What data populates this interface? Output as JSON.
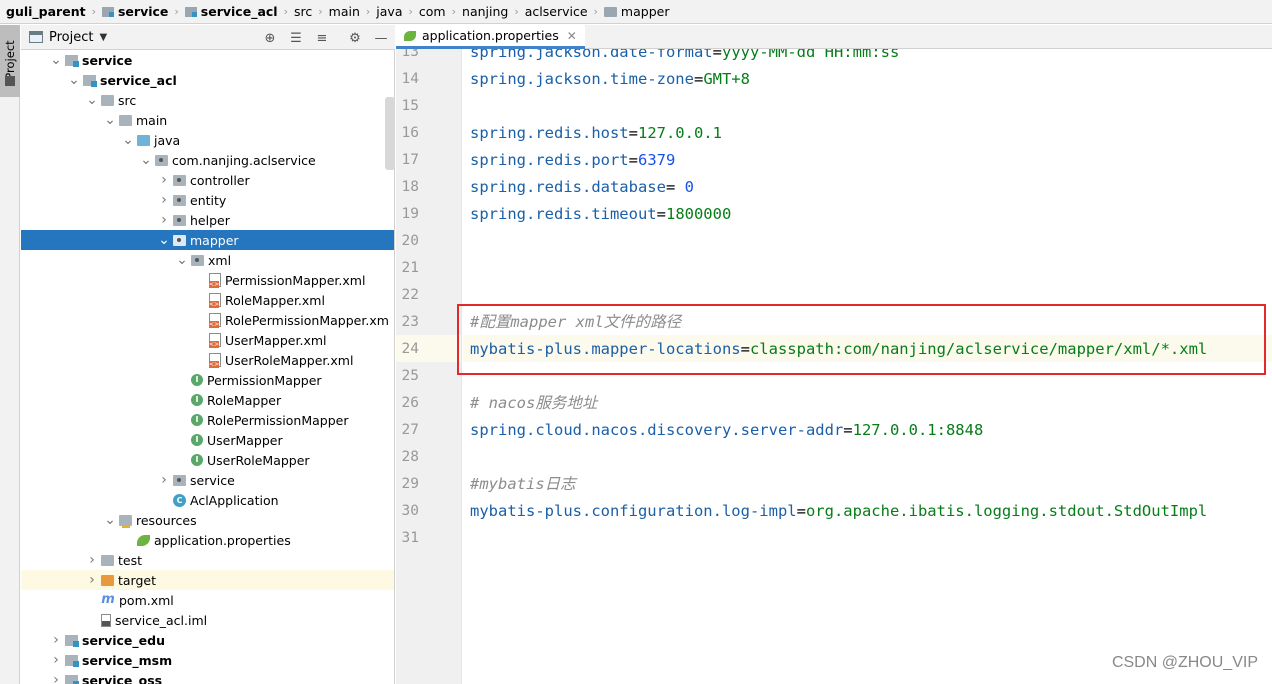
{
  "breadcrumb": [
    "guli_parent",
    "service",
    "service_acl",
    "src",
    "main",
    "java",
    "com",
    "nanjing",
    "aclservice",
    "mapper"
  ],
  "tool_strip": {
    "project_label": "Project"
  },
  "project_panel": {
    "title": "Project"
  },
  "tree": [
    {
      "label": "service",
      "bold": true,
      "arrow": "down",
      "icon": "module"
    },
    {
      "label": "service_acl",
      "bold": true,
      "arrow": "down",
      "icon": "module"
    },
    {
      "label": "src",
      "arrow": "down",
      "icon": "folder"
    },
    {
      "label": "main",
      "arrow": "down",
      "icon": "folder"
    },
    {
      "label": "java",
      "arrow": "down",
      "icon": "folder-blue"
    },
    {
      "label": "com.nanjing.aclservice",
      "arrow": "down",
      "icon": "pkg"
    },
    {
      "label": "controller",
      "arrow": "right",
      "icon": "pkg"
    },
    {
      "label": "entity",
      "arrow": "right",
      "icon": "pkg"
    },
    {
      "label": "helper",
      "arrow": "right",
      "icon": "pkg"
    },
    {
      "label": "mapper",
      "arrow": "down",
      "icon": "pkg",
      "selected": true
    },
    {
      "label": "xml",
      "arrow": "down",
      "icon": "pkg"
    },
    {
      "label": "PermissionMapper.xml",
      "icon": "xml"
    },
    {
      "label": "RoleMapper.xml",
      "icon": "xml"
    },
    {
      "label": "RolePermissionMapper.xm",
      "icon": "xml"
    },
    {
      "label": "UserMapper.xml",
      "icon": "xml"
    },
    {
      "label": "UserRoleMapper.xml",
      "icon": "xml"
    },
    {
      "label": "PermissionMapper",
      "icon": "iface"
    },
    {
      "label": "RoleMapper",
      "icon": "iface"
    },
    {
      "label": "RolePermissionMapper",
      "icon": "iface"
    },
    {
      "label": "UserMapper",
      "icon": "iface"
    },
    {
      "label": "UserRoleMapper",
      "icon": "iface"
    },
    {
      "label": "service",
      "arrow": "right",
      "icon": "pkg"
    },
    {
      "label": "AclApplication",
      "icon": "class"
    },
    {
      "label": "resources",
      "arrow": "down",
      "icon": "folder-res"
    },
    {
      "label": "application.properties",
      "icon": "leaf"
    },
    {
      "label": "test",
      "arrow": "right",
      "icon": "folder"
    },
    {
      "label": "target",
      "arrow": "right",
      "icon": "folder-orange",
      "excluded": true
    },
    {
      "label": "pom.xml",
      "icon": "maven"
    },
    {
      "label": "service_acl.iml",
      "icon": "iml"
    },
    {
      "label": "service_edu",
      "bold": true,
      "arrow": "right",
      "icon": "module"
    },
    {
      "label": "service_msm",
      "bold": true,
      "arrow": "right",
      "icon": "module"
    },
    {
      "label": "service_oss",
      "bold": true,
      "arrow": "right",
      "icon": "module"
    }
  ],
  "editor": {
    "tab_label": "application.properties",
    "lines": [
      {
        "n": "13",
        "parts": [
          {
            "t": "spring.jackson.date-format",
            "c": "k"
          },
          {
            "t": "=",
            "c": ""
          },
          {
            "t": "yyyy-MM-dd HH:mm:ss",
            "c": "v"
          }
        ]
      },
      {
        "n": "14",
        "parts": [
          {
            "t": "spring.jackson.time-zone",
            "c": "k"
          },
          {
            "t": "=",
            "c": ""
          },
          {
            "t": "GMT+8",
            "c": "v"
          }
        ]
      },
      {
        "n": "15",
        "parts": []
      },
      {
        "n": "16",
        "parts": [
          {
            "t": "spring.redis.host",
            "c": "k"
          },
          {
            "t": "=",
            "c": ""
          },
          {
            "t": "127.0.0.1",
            "c": "v"
          }
        ]
      },
      {
        "n": "17",
        "parts": [
          {
            "t": "spring.redis.port",
            "c": "k"
          },
          {
            "t": "=",
            "c": ""
          },
          {
            "t": "6379",
            "c": "vn"
          }
        ]
      },
      {
        "n": "18",
        "parts": [
          {
            "t": "spring.redis.database",
            "c": "k"
          },
          {
            "t": "= ",
            "c": ""
          },
          {
            "t": "0",
            "c": "vn"
          }
        ]
      },
      {
        "n": "19",
        "parts": [
          {
            "t": "spring.redis.timeout",
            "c": "k"
          },
          {
            "t": "=",
            "c": ""
          },
          {
            "t": "1800000",
            "c": "v"
          }
        ]
      },
      {
        "n": "20",
        "parts": []
      },
      {
        "n": "21",
        "parts": []
      },
      {
        "n": "22",
        "parts": []
      },
      {
        "n": "23",
        "parts": [
          {
            "t": "#配置mapper xml文件的路径",
            "c": "cm"
          }
        ]
      },
      {
        "n": "24",
        "parts": [
          {
            "t": "mybatis-plus.mapper-locations",
            "c": "k"
          },
          {
            "t": "=",
            "c": ""
          },
          {
            "t": "classpath:com/nanjing/aclservice/mapper/xml/*.xml",
            "c": "v"
          }
        ]
      },
      {
        "n": "25",
        "parts": []
      },
      {
        "n": "26",
        "parts": [
          {
            "t": "# nacos服务地址",
            "c": "cm"
          }
        ]
      },
      {
        "n": "27",
        "parts": [
          {
            "t": "spring.cloud.nacos.discovery.server-addr",
            "c": "k"
          },
          {
            "t": "=",
            "c": ""
          },
          {
            "t": "127.0.0.1:8848",
            "c": "v"
          }
        ]
      },
      {
        "n": "28",
        "parts": []
      },
      {
        "n": "29",
        "parts": [
          {
            "t": "#mybatis日志",
            "c": "cm"
          }
        ]
      },
      {
        "n": "30",
        "parts": [
          {
            "t": "mybatis-plus.configuration.log-impl",
            "c": "k"
          },
          {
            "t": "=",
            "c": ""
          },
          {
            "t": "org.apache.ibatis.logging.stdout.StdOutImpl",
            "c": "v"
          }
        ]
      },
      {
        "n": "31",
        "parts": []
      }
    ]
  },
  "watermark": "CSDN @ZHOU_VIP"
}
